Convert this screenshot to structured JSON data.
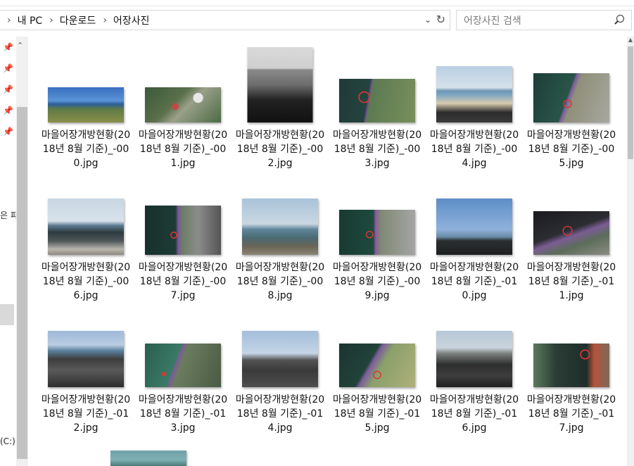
{
  "address": {
    "crumbs": [
      "내 PC",
      "다운로드",
      "어장사진"
    ],
    "separator": "›"
  },
  "search": {
    "placeholder": "어장사진 검색"
  },
  "navpane": {
    "text_fragment": "은 파",
    "drive_fragment": "(C:)"
  },
  "files": [
    {
      "name": "마을어장개방현황(2018년 8월 기준)_-000.jpg",
      "thumb": "coast1"
    },
    {
      "name": "마을어장개방현황(2018년 8월 기준)_-001.jpg",
      "thumb": "aerial1"
    },
    {
      "name": "마을어장개방현황(2018년 8월 기준)_-002.jpg",
      "thumb": "bw"
    },
    {
      "name": "마을어장개방현황(2018년 8월 기준)_-003.jpg",
      "thumb": "aerial2"
    },
    {
      "name": "마을어장개방현황(2018년 8월 기준)_-004.jpg",
      "thumb": "beach"
    },
    {
      "name": "마을어장개방현황(2018년 8월 기준)_-005.jpg",
      "thumb": "aerial3"
    },
    {
      "name": "마을어장개방현황(2018년 8월 기준)_-006.jpg",
      "thumb": "rocks1"
    },
    {
      "name": "마을어장개방현황(2018년 8월 기준)_-007.jpg",
      "thumb": "aerial4"
    },
    {
      "name": "마을어장개방현황(2018년 8월 기준)_-008.jpg",
      "thumb": "sea2"
    },
    {
      "name": "마을어장개방현황(2018년 8월 기준)_-009.jpg",
      "thumb": "aerial5"
    },
    {
      "name": "마을어장개방현황(2018년 8월 기준)_-010.jpg",
      "thumb": "sky"
    },
    {
      "name": "마을어장개방현황(2018년 8월 기준)_-011.jpg",
      "thumb": "aerial6"
    },
    {
      "name": "마을어장개방현황(2018년 8월 기준)_-012.jpg",
      "thumb": "rocks2"
    },
    {
      "name": "마을어장개방현황(2018년 8월 기준)_-013.jpg",
      "thumb": "aerial7"
    },
    {
      "name": "마을어장개방현황(2018년 8월 기준)_-014.jpg",
      "thumb": "rocks3"
    },
    {
      "name": "마을어장개방현황(2018년 8월 기준)_-015.jpg",
      "thumb": "aerial8"
    },
    {
      "name": "마을어장개방현황(2018년 8월 기준)_-016.jpg",
      "thumb": "rocks4"
    },
    {
      "name": "마을어장개방현황(2018년 8월 기준)_-017.jpg",
      "thumb": "aerial9"
    }
  ]
}
